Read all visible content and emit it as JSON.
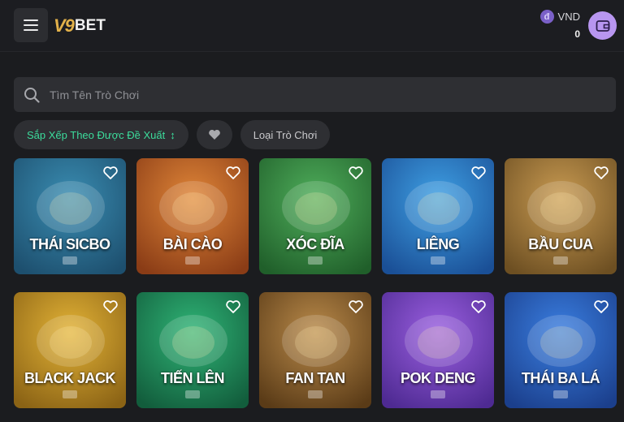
{
  "header": {
    "logo_mark": "V9",
    "logo_text": "BET",
    "currency": "VND",
    "currency_coin": "đ",
    "balance": "0"
  },
  "search": {
    "placeholder": "Tìm Tên Trò Chơi"
  },
  "filters": {
    "sort_label": "Sắp Xếp Theo Được Đề Xuất",
    "sort_icon": "↕",
    "type_label": "Loại Trò Chơi"
  },
  "games": [
    {
      "title": "THÁI SICBO",
      "bg1": "#3a8db2",
      "bg2": "#1d4f6e"
    },
    {
      "title": "BÀI CÀO",
      "bg1": "#e08638",
      "bg2": "#8a3c16"
    },
    {
      "title": "XÓC ĐĨA",
      "bg1": "#4fae5b",
      "bg2": "#205f2a"
    },
    {
      "title": "LIÊNG",
      "bg1": "#3fa0e4",
      "bg2": "#1a4f96"
    },
    {
      "title": "BẦU CUA",
      "bg1": "#c99b52",
      "bg2": "#6d4f22"
    },
    {
      "title": "BLACK JACK",
      "bg1": "#e2b236",
      "bg2": "#8b6315"
    },
    {
      "title": "TIẾN LÊN",
      "bg1": "#2fb476",
      "bg2": "#125d3c"
    },
    {
      "title": "FAN TAN",
      "bg1": "#b98a4a",
      "bg2": "#5a3b17"
    },
    {
      "title": "POK DENG",
      "bg1": "#9a5fe0",
      "bg2": "#4e2a92"
    },
    {
      "title": "THÁI BA LÁ",
      "bg1": "#3a7ee0",
      "bg2": "#1b3f8c"
    }
  ],
  "colors": {
    "accent_green": "#3cdc9c",
    "wallet_purple": "#b896f0"
  }
}
